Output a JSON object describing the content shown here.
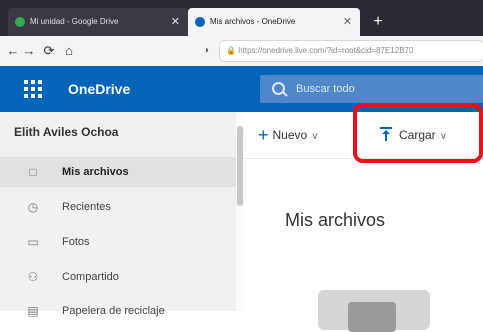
{
  "browser": {
    "tabs": [
      {
        "title": "Mi unidad - Google Drive",
        "favicon_color": "#34a853",
        "active": false
      },
      {
        "title": "Mis archivos - OneDrive",
        "favicon_color": "#0364b8",
        "active": true
      }
    ],
    "close_glyph": "✕",
    "new_tab_glyph": "+",
    "nav": {
      "back": "←",
      "forward": "→",
      "reload": "⟳",
      "home": "⌂"
    },
    "url": "https://onedrive.live.com/?id=root&cid=87E12B70"
  },
  "header": {
    "brand": "OneDrive",
    "search_placeholder": "Buscar todo",
    "bg_color": "#0364b8"
  },
  "sidebar": {
    "user_name": "Elith Aviles Ochoa",
    "items": [
      {
        "label": "Mis archivos",
        "icon": "folder-icon",
        "selected": true
      },
      {
        "label": "Recientes",
        "icon": "clock-icon",
        "selected": false
      },
      {
        "label": "Fotos",
        "icon": "photo-icon",
        "selected": false
      },
      {
        "label": "Compartido",
        "icon": "people-icon",
        "selected": false
      },
      {
        "label": "Papelera de reciclaje",
        "icon": "trash-icon",
        "selected": false
      }
    ]
  },
  "commandbar": {
    "new_label": "Nuevo",
    "upload_label": "Cargar"
  },
  "main": {
    "title": "Mis archivos"
  },
  "annotation": {
    "highlight_color": "#e8121a"
  }
}
